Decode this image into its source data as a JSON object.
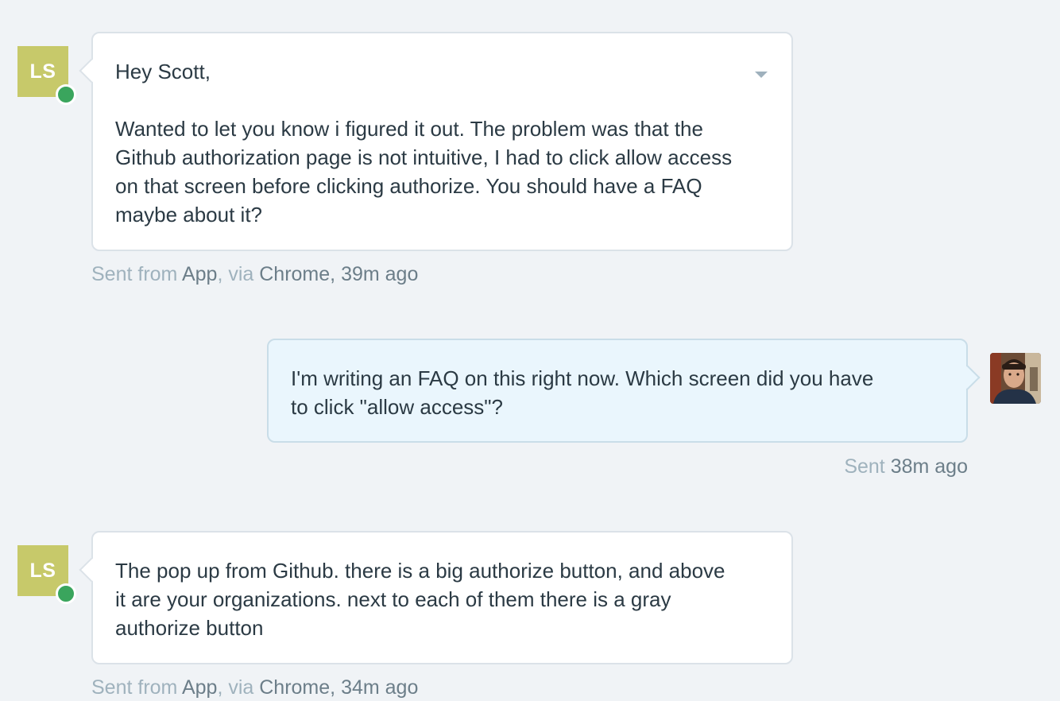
{
  "messages": [
    {
      "author_initials": "LS",
      "status": "online",
      "paragraphs": [
        "Hey Scott,",
        "Wanted to let you know i figured it out. The problem was that the Github authorization page is not intuitive, I had to click allow access on that screen before clicking authorize. You should have a FAQ maybe about it?"
      ],
      "meta": {
        "sent_from_label": "Sent from",
        "app": "App",
        "via_label": ", via",
        "browser": "Chrome",
        "time": ", 39m ago"
      }
    },
    {
      "author": "agent",
      "avatar_icon": "user-photo-icon",
      "paragraphs": [
        "I'm writing an FAQ on this right now. Which screen did you have to click \"allow access\"?"
      ],
      "meta": {
        "sent_label": "Sent",
        "time": "38m ago"
      }
    },
    {
      "author_initials": "LS",
      "status": "online",
      "paragraphs": [
        "The pop up from Github. there is a big authorize button, and above it are your organizations. next to each of them there is a gray authorize button"
      ],
      "meta": {
        "sent_from_label": "Sent from",
        "app": "App",
        "via_label": ", via",
        "browser": "Chrome",
        "time": ", 34m ago"
      }
    }
  ],
  "colors": {
    "background": "#f0f3f6",
    "avatar_initials_bg": "#c7c96a",
    "online": "#3aa55d",
    "outgoing_bubble": "#eaf6fd"
  }
}
